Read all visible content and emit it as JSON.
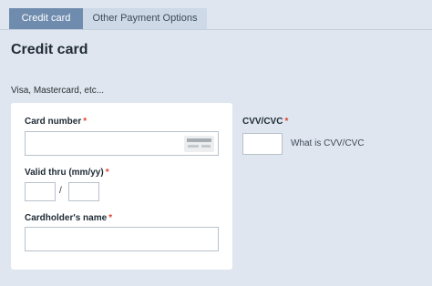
{
  "tabs": [
    {
      "label": "Credit card",
      "active": true
    },
    {
      "label": "Other Payment Options",
      "active": false
    }
  ],
  "page": {
    "title": "Credit card",
    "subtitle": "Visa, Mastercard, etc..."
  },
  "form": {
    "card_number_label": "Card number",
    "valid_thru_label": "Valid thru (mm/yy)",
    "slash": "/",
    "cardholder_label": "Cardholder's name",
    "cvv_label": "CVV/CVC",
    "cvv_help": "What is CVV/CVC",
    "required_mark": "*"
  },
  "icons": {
    "card_field": "credit-card-icon"
  },
  "colors": {
    "background": "#dfe6ef",
    "active_tab": "#6f8cae",
    "inactive_tab": "#cdd9e6",
    "required": "#e0442f"
  }
}
